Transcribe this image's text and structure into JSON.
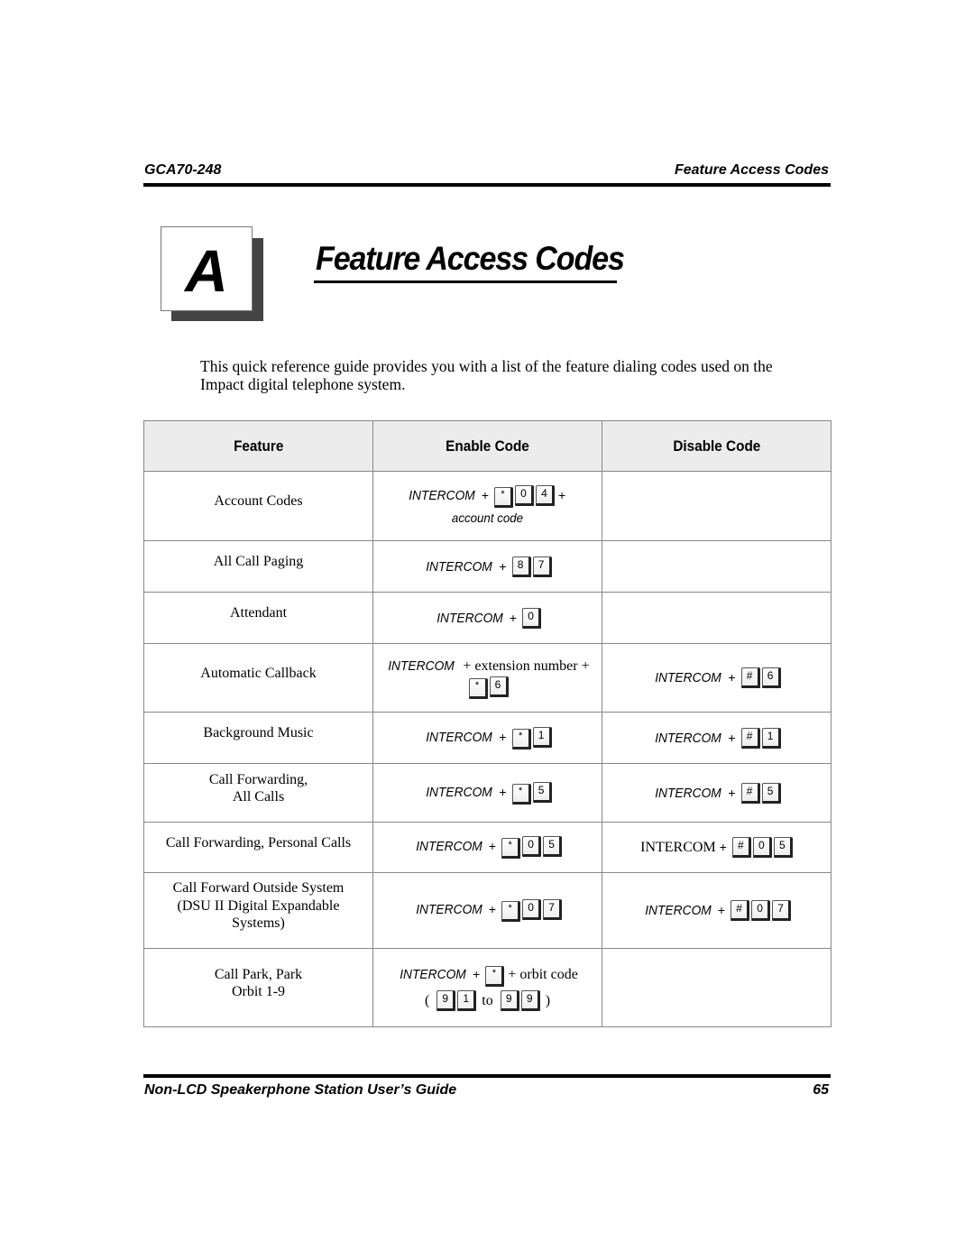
{
  "header": {
    "doc_code": "GCA70-248",
    "section": "Feature Access Codes"
  },
  "chapter": {
    "tab_letter": "A",
    "title": "Feature Access Codes"
  },
  "intro": "This quick reference guide provides you with a list of the feature dialing codes used on the Impact digital telephone system.",
  "table": {
    "columns": [
      "Feature",
      "Enable Code",
      "Disable Code"
    ],
    "rows": [
      {
        "feature": [
          "Account Codes"
        ],
        "enable": {
          "prefix": "INTERCOM",
          "keys": [
            "*",
            "0",
            "4"
          ],
          "suffix": "+",
          "line2": "account code"
        },
        "disable": null
      },
      {
        "feature": [
          "All Call Paging"
        ],
        "enable": {
          "prefix": "INTERCOM",
          "keys": [
            "8",
            "7"
          ]
        },
        "disable": null
      },
      {
        "feature": [
          "Attendant"
        ],
        "enable": {
          "prefix": "INTERCOM",
          "keys": [
            "0"
          ]
        },
        "disable": null
      },
      {
        "feature": [
          "Automatic Callback"
        ],
        "enable": {
          "prefix": "INTERCOM",
          "middle": "+ extension number +",
          "keys": [
            "*",
            "6"
          ]
        },
        "disable": {
          "prefix": "INTERCOM",
          "keys": [
            "#",
            "6"
          ]
        }
      },
      {
        "feature": [
          "Background Music"
        ],
        "enable": {
          "prefix": "INTERCOM",
          "keys": [
            "*",
            "1"
          ]
        },
        "disable": {
          "prefix": "INTERCOM",
          "keys": [
            "#",
            "1"
          ]
        }
      },
      {
        "feature": [
          "Call Forwarding,",
          "All Calls"
        ],
        "enable": {
          "prefix": "INTERCOM",
          "keys": [
            "*",
            "5"
          ]
        },
        "disable": {
          "prefix": "INTERCOM",
          "keys": [
            "#",
            "5"
          ]
        }
      },
      {
        "feature": [
          "Call Forwarding, Personal Calls"
        ],
        "enable": {
          "prefix": "INTERCOM",
          "keys": [
            "*",
            "0",
            "5"
          ]
        },
        "disable": {
          "prefix": "INTERCOM",
          "keys": [
            "#",
            "0",
            "5"
          ],
          "roman": true
        }
      },
      {
        "feature": [
          "Call Forward Outside System",
          "(DSU II Digital Expandable",
          "Systems)"
        ],
        "enable": {
          "prefix": "INTERCOM",
          "keys": [
            "*",
            "0",
            "7"
          ]
        },
        "disable": {
          "prefix": "INTERCOM",
          "keys": [
            "#",
            "0",
            "7"
          ]
        }
      },
      {
        "feature": [
          "Call Park, Park",
          "Orbit 1-9"
        ],
        "enable": {
          "prefix": "INTERCOM",
          "keys": [
            "*"
          ],
          "suffix_text": "+ orbit code",
          "range": {
            "open": "(",
            "from": [
              "9",
              "1"
            ],
            "to_word": "to",
            "to": [
              "9",
              "9"
            ],
            "close": ")"
          }
        },
        "disable": null
      }
    ]
  },
  "footer": {
    "guide_title": "Non-LCD Speakerphone Station User’s Guide",
    "page_number": "65"
  }
}
